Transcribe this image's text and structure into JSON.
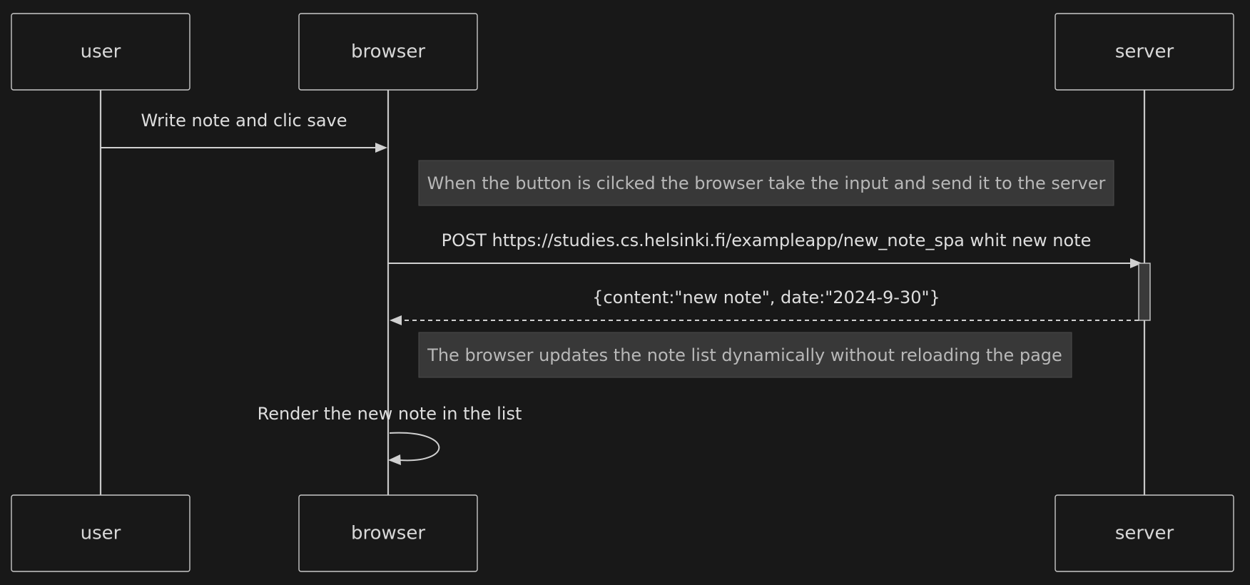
{
  "diagram": {
    "type": "sequence",
    "participants": [
      {
        "id": "user",
        "label": "user"
      },
      {
        "id": "browser",
        "label": "browser"
      },
      {
        "id": "server",
        "label": "server"
      }
    ],
    "messages": [
      {
        "id": "m1",
        "from": "user",
        "to": "browser",
        "label": "Write note and clic save",
        "style": "solid"
      },
      {
        "id": "m2",
        "from": "browser",
        "to": "server",
        "label": "POST https://studies.cs.helsinki.fi/exampleapp/new_note_spa whit new note",
        "style": "solid"
      },
      {
        "id": "m3",
        "from": "server",
        "to": "browser",
        "label": "{content:\"new note\", date:\"2024-9-30\"}",
        "style": "dashed"
      },
      {
        "id": "m4",
        "from": "browser",
        "to": "browser",
        "label": "Render the new note in the list",
        "style": "solid"
      }
    ],
    "notes": [
      {
        "id": "n1",
        "label": "When the button is cilcked the browser take the input and send it to the server"
      },
      {
        "id": "n2",
        "label": "The browser updates the note list dynamically without reloading the page"
      }
    ]
  },
  "colors": {
    "background": "#181818",
    "stroke": "#c8c8c8",
    "text": "#dedede",
    "note_fill": "#383838",
    "note_text": "#b8b8b8"
  }
}
